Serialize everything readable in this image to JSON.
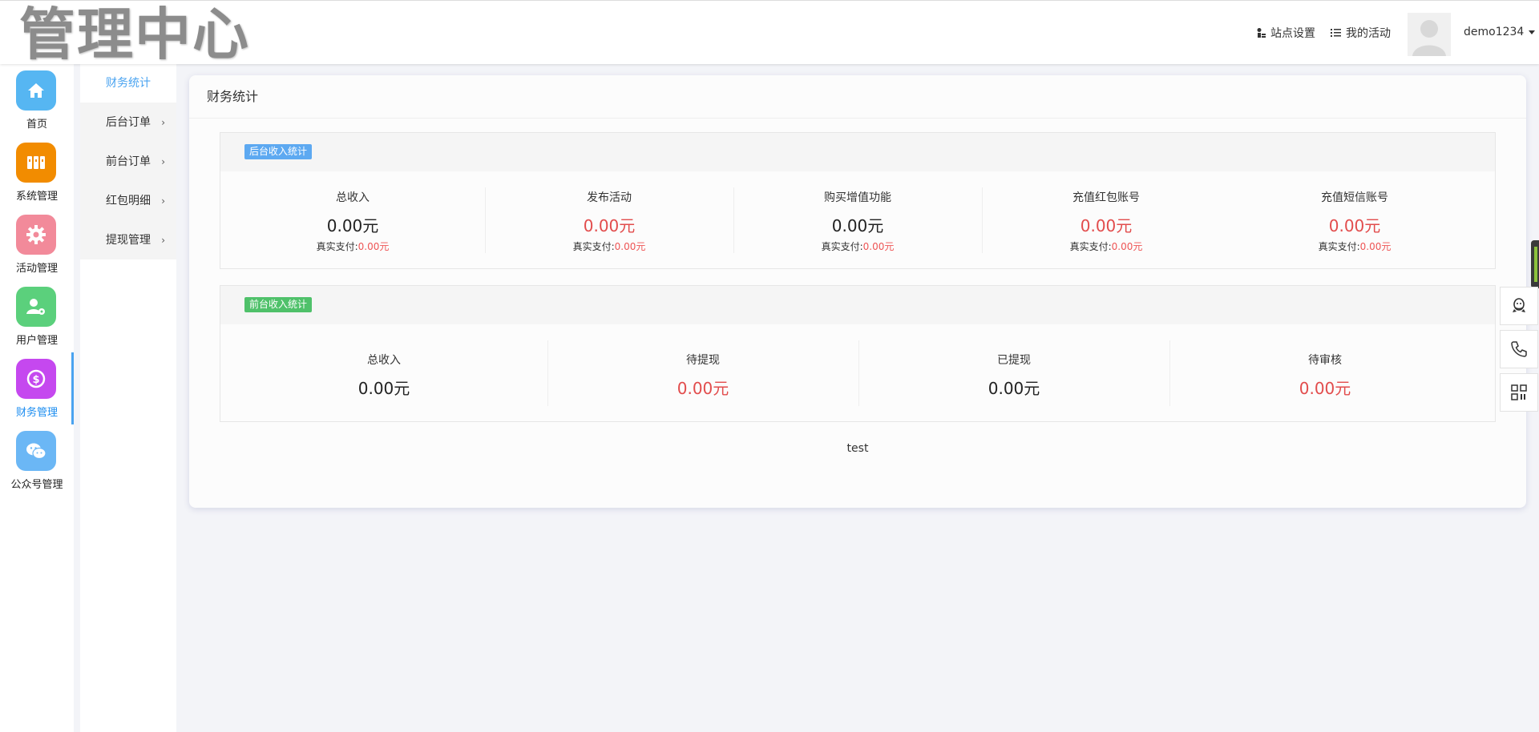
{
  "header": {
    "logo_text": "管理中心",
    "site_settings_label": "站点设置",
    "my_activity_label": "我的活动",
    "username": "demo1234"
  },
  "sidebar": {
    "items": [
      {
        "label": "首页",
        "icon": "home-icon",
        "color": "#56b6f2"
      },
      {
        "label": "系统管理",
        "icon": "grid-icon",
        "color": "#f28c00"
      },
      {
        "label": "活动管理",
        "icon": "gear-icon",
        "color": "#f28a9a"
      },
      {
        "label": "用户管理",
        "icon": "user-settings-icon",
        "color": "#5bd07c"
      },
      {
        "label": "财务管理",
        "icon": "dollar-icon",
        "color": "#c548ef"
      },
      {
        "label": "公众号管理",
        "icon": "wechat-icon",
        "color": "#6bb7f5"
      }
    ],
    "active_index": 4
  },
  "subnav": {
    "items": [
      {
        "label": "财务统计",
        "has_arrow": false
      },
      {
        "label": "后台订单",
        "has_arrow": true
      },
      {
        "label": "前台订单",
        "has_arrow": true
      },
      {
        "label": "红包明细",
        "has_arrow": true
      },
      {
        "label": "提现管理",
        "has_arrow": true
      }
    ],
    "arrow": "›"
  },
  "main": {
    "title": "财务统计",
    "backend": {
      "tag": "后台收入统计",
      "tag_color": "#5da9f1",
      "stats": [
        {
          "title": "总收入",
          "value": "0.00元",
          "paid_label": "真实支付:",
          "paid_value": "0.00元"
        },
        {
          "title": "发布活动",
          "value": "0.00元",
          "paid_label": "真实支付:",
          "paid_value": "0.00元"
        },
        {
          "title": "购买增值功能",
          "value": "0.00元",
          "paid_label": "真实支付:",
          "paid_value": "0.00元"
        },
        {
          "title": "充值红包账号",
          "value": "0.00元",
          "paid_label": "真实支付:",
          "paid_value": "0.00元"
        },
        {
          "title": "充值短信账号",
          "value": "0.00元",
          "paid_label": "真实支付:",
          "paid_value": "0.00元"
        }
      ]
    },
    "frontend": {
      "tag": "前台收入统计",
      "tag_color": "#4fc16a",
      "stats": [
        {
          "title": "总收入",
          "value": "0.00元"
        },
        {
          "title": "待提现",
          "value": "0.00元"
        },
        {
          "title": "已提现",
          "value": "0.00元"
        },
        {
          "title": "待审核",
          "value": "0.00元"
        }
      ]
    },
    "footer": "test"
  },
  "colors": {
    "accent": "#4aa3f0",
    "value_red": "#e24c4c"
  }
}
